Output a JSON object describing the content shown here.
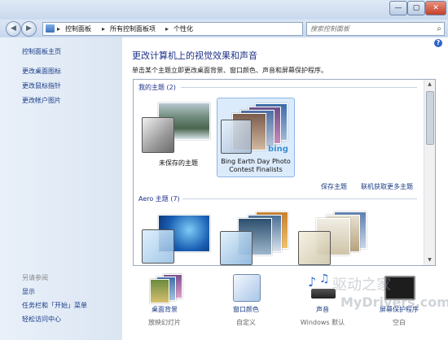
{
  "window": {
    "title": "",
    "minimize": "—",
    "maximize": "▢",
    "close": "✕"
  },
  "nav": {
    "back": "◀",
    "forward": "▶",
    "breadcrumbs": [
      "控制面板",
      "所有控制面板项",
      "个性化"
    ],
    "separator": "▸",
    "dropdown": "▾",
    "refresh": "↻",
    "search_placeholder": "搜索控制面板",
    "search_icon": "⌕"
  },
  "sidebar": {
    "home": "控制面板主页",
    "links": [
      "更改桌面图标",
      "更改鼠标指针",
      "更改帐户图片"
    ],
    "see_also_title": "另请参阅",
    "see_also": [
      "显示",
      "任务栏和「开始」菜单",
      "轻松访问中心"
    ]
  },
  "main": {
    "help": "?",
    "heading": "更改计算机上的视觉效果和声音",
    "subtext": "单击某个主题立即更改桌面背景、窗口颜色、声音和屏幕保护程序。",
    "my_themes_label": "我的主题 (2)",
    "themes": [
      {
        "name": "未保存的主题",
        "selected": false
      },
      {
        "name_line1": "Bing Earth Day Photo",
        "name_line2": "Contest Finalists",
        "brand": "bing",
        "selected": true
      }
    ],
    "save_theme": "保存主题",
    "get_more": "联机获取更多主题",
    "aero_label": "Aero 主题 (7)"
  },
  "bottom": [
    {
      "label": "桌面背景",
      "value": "放映幻灯片",
      "icon": "desktop-background-icon"
    },
    {
      "label": "窗口颜色",
      "value": "自定义",
      "icon": "window-color-icon"
    },
    {
      "label": "声音",
      "value": "Windows 默认",
      "icon": "sounds-icon"
    },
    {
      "label": "屏幕保护程序",
      "value": "空白",
      "icon": "screensaver-icon"
    }
  ],
  "watermark": {
    "text1": "驱动之家",
    "text2": "MyDrivers.com"
  },
  "colors": {
    "link": "#1a3b86",
    "heading": "#1e3287",
    "selection": "#dcebfb"
  }
}
